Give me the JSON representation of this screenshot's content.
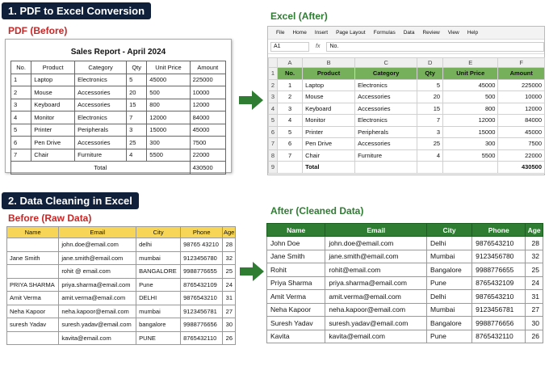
{
  "section1": {
    "title": "1. PDF to Excel Conversion",
    "pdf_label": "PDF (Before)",
    "excel_label": "Excel (After)",
    "pdf": {
      "title": "Sales Report - April 2024",
      "headers": [
        "No.",
        "Product",
        "Category",
        "Qty",
        "Unit Price",
        "Amount"
      ],
      "rows": [
        [
          "1",
          "Laptop",
          "Electronics",
          "5",
          "45000",
          "225000"
        ],
        [
          "2",
          "Mouse",
          "Accessories",
          "20",
          "500",
          "10000"
        ],
        [
          "3",
          "Keyboard",
          "Accessories",
          "15",
          "800",
          "12000"
        ],
        [
          "4",
          "Monitor",
          "Electronics",
          "7",
          "12000",
          "84000"
        ],
        [
          "5",
          "Printer",
          "Peripherals",
          "3",
          "15000",
          "45000"
        ],
        [
          "6",
          "Pen Drive",
          "Accessories",
          "25",
          "300",
          "7500"
        ],
        [
          "7",
          "Chair",
          "Furniture",
          "4",
          "5500",
          "22000"
        ]
      ],
      "total_label": "Total",
      "total_value": "430500"
    },
    "excel": {
      "menu": [
        "File",
        "Home",
        "Insert",
        "Page Layout",
        "Formulas",
        "Data",
        "Review",
        "View",
        "Help"
      ],
      "name_box": "A1",
      "fx": "fx",
      "formula": "No.",
      "columns": [
        "A",
        "B",
        "C",
        "D",
        "E",
        "F"
      ],
      "row_numbers": [
        "1",
        "2",
        "3",
        "4",
        "5",
        "6",
        "7",
        "8",
        "9"
      ],
      "headers": [
        "No.",
        "Product",
        "Category",
        "Qty",
        "Unit Price",
        "Amount"
      ],
      "rows": [
        [
          "1",
          "Laptop",
          "Electronics",
          "5",
          "45000",
          "225000"
        ],
        [
          "2",
          "Mouse",
          "Accessories",
          "20",
          "500",
          "10000"
        ],
        [
          "3",
          "Keyboard",
          "Accessories",
          "15",
          "800",
          "12000"
        ],
        [
          "4",
          "Monitor",
          "Electronics",
          "7",
          "12000",
          "84000"
        ],
        [
          "5",
          "Printer",
          "Peripherals",
          "3",
          "15000",
          "45000"
        ],
        [
          "6",
          "Pen Drive",
          "Accessories",
          "25",
          "300",
          "7500"
        ],
        [
          "7",
          "Chair",
          "Furniture",
          "4",
          "5500",
          "22000"
        ]
      ],
      "total_label": "Total",
      "total_value": "430500"
    }
  },
  "section2": {
    "title": "2. Data Cleaning in Excel",
    "raw_label": "Before (Raw Data)",
    "clean_label": "After (Cleaned Data)",
    "headers": [
      "Name",
      "Email",
      "City",
      "Phone",
      "Age"
    ],
    "raw_rows": [
      [
        "",
        "john.doe@email.com",
        "delhi",
        "98765 43210",
        "28"
      ],
      [
        "Jane Smith",
        "jane.smith@email.com",
        "mumbai",
        "9123456780",
        "32"
      ],
      [
        "",
        "rohit @ email.com",
        "BANGALORE",
        "9988776655",
        "25"
      ],
      [
        "PRIYA SHARMA",
        "priya.sharma@email.com",
        "Pune",
        "8765432109",
        "24"
      ],
      [
        "Amit Verma",
        "amit.verma@email.com",
        "DELHI",
        "9876543210",
        "31"
      ],
      [
        "Neha Kapoor",
        "neha.kapoor@email.com",
        "mumbai",
        "9123456781",
        "27"
      ],
      [
        "suresh Yadav",
        "suresh.yadav@email.com",
        "bangalore",
        "9988776656",
        "30"
      ],
      [
        "",
        "kavita@email.com",
        "PUNE",
        "8765432110",
        "26"
      ]
    ],
    "clean_rows": [
      [
        "John Doe",
        "john.doe@email.com",
        "Delhi",
        "9876543210",
        "28"
      ],
      [
        "Jane Smith",
        "jane.smith@email.com",
        "Mumbai",
        "9123456780",
        "32"
      ],
      [
        "Rohit",
        "rohit@email.com",
        "Bangalore",
        "9988776655",
        "25"
      ],
      [
        "Priya Sharma",
        "priya.sharma@email.com",
        "Pune",
        "8765432109",
        "24"
      ],
      [
        "Amit Verma",
        "amit.verma@email.com",
        "Delhi",
        "9876543210",
        "31"
      ],
      [
        "Neha Kapoor",
        "neha.kapoor@email.com",
        "Mumbai",
        "9123456781",
        "27"
      ],
      [
        "Suresh Yadav",
        "suresh.yadav@email.com",
        "Bangalore",
        "9988776656",
        "30"
      ],
      [
        "Kavita",
        "kavita@email.com",
        "Pune",
        "8765432110",
        "26"
      ]
    ]
  },
  "colors": {
    "banner": "#10203a",
    "before": "#c62828",
    "after": "#2e7d32",
    "excel_header": "#76b05a",
    "raw_header": "#f7d657",
    "clean_header": "#2e7d32",
    "arrow": "#2e7d32"
  },
  "icons": [
    "right-arrow-icon"
  ]
}
